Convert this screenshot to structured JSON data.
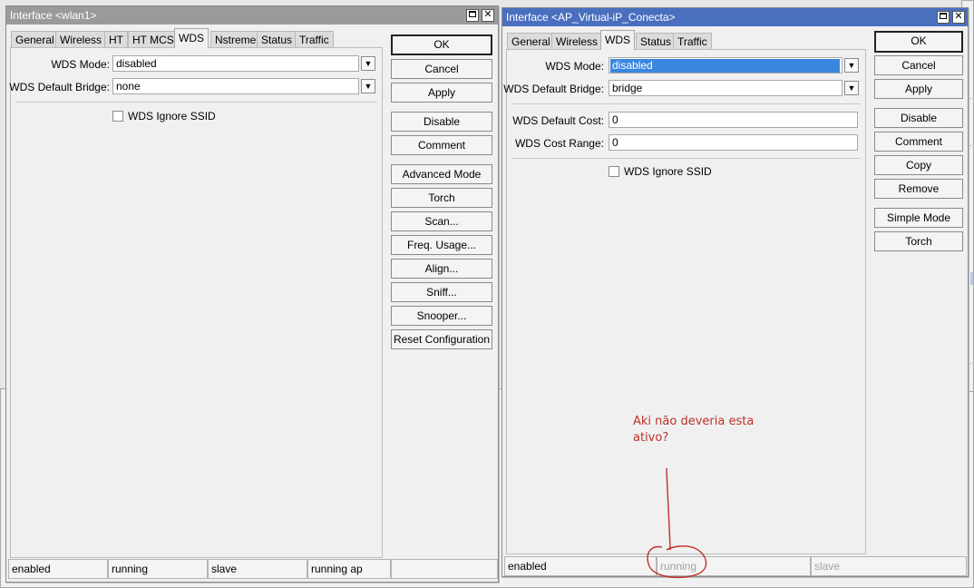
{
  "background": {
    "colors": {
      "desktop": "#e6e6e6",
      "window": "#f0f0f0"
    }
  },
  "window_left": {
    "title": "Interface <wlan1>",
    "tabs": [
      "General",
      "Wireless",
      "HT",
      "HT MCS",
      "WDS",
      "Nstreme",
      "Status",
      "Traffic"
    ],
    "selected_tab": "WDS",
    "wds_mode_label": "WDS Mode:",
    "wds_mode_value": "disabled",
    "wds_default_bridge_label": "WDS Default Bridge:",
    "wds_default_bridge_value": "none",
    "wds_ignore_ssid_label": "WDS Ignore SSID",
    "wds_ignore_ssid_checked": false,
    "buttons": {
      "ok": "OK",
      "cancel": "Cancel",
      "apply": "Apply",
      "disable": "Disable",
      "comment": "Comment",
      "advanced_mode": "Advanced Mode",
      "torch": "Torch",
      "scan": "Scan...",
      "freq_usage": "Freq. Usage...",
      "align": "Align...",
      "sniff": "Sniff...",
      "snooper": "Snooper...",
      "reset_configuration": "Reset Configuration"
    },
    "status": [
      "enabled",
      "running",
      "slave",
      "running ap",
      ""
    ]
  },
  "window_right": {
    "title": "Interface <AP_Virtual-iP_Conecta>",
    "tabs": [
      "General",
      "Wireless",
      "WDS",
      "Status",
      "Traffic"
    ],
    "selected_tab": "WDS",
    "wds_mode_label": "WDS Mode:",
    "wds_mode_value": "disabled",
    "wds_default_bridge_label": "WDS Default Bridge:",
    "wds_default_bridge_value": "bridge",
    "wds_default_cost_label": "WDS Default Cost:",
    "wds_default_cost_value": "0",
    "wds_cost_range_label": "WDS Cost Range:",
    "wds_cost_range_value": "0",
    "wds_ignore_ssid_label": "WDS Ignore SSID",
    "wds_ignore_ssid_checked": false,
    "buttons": {
      "ok": "OK",
      "cancel": "Cancel",
      "apply": "Apply",
      "disable": "Disable",
      "comment": "Comment",
      "copy": "Copy",
      "remove": "Remove",
      "simple_mode": "Simple Mode",
      "torch": "Torch"
    },
    "status": [
      "enabled",
      "running",
      "slave"
    ]
  },
  "annotation": {
    "text": "Aki não deveria esta\nativo?",
    "color": "#c0302a"
  },
  "colors": {
    "active_title": "#4a6fbf",
    "inactive_title": "#9a9a9a",
    "selection": "#3a86de"
  }
}
